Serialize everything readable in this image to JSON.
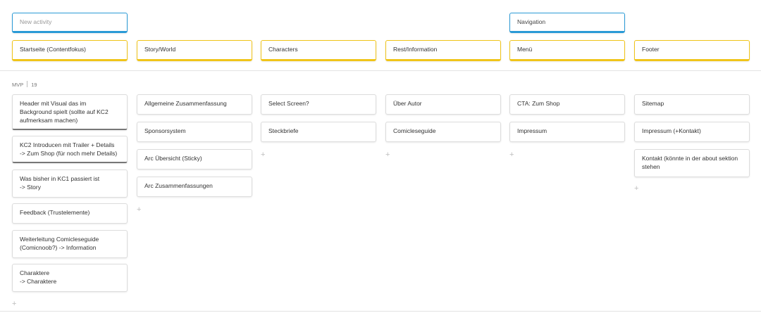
{
  "activities": [
    {
      "label": "New activity",
      "placeholder": true
    },
    {
      "label": "Navigation",
      "placeholder": false
    }
  ],
  "steps": [
    "Startseite (Contentfokus)",
    "Story/World",
    "Characters",
    "Rest/Information",
    "Menü",
    "Footer"
  ],
  "release": {
    "name": "MVP",
    "count": "19"
  },
  "columns": [
    [
      "Header mit Visual das im\nBackground spielt (sollte auf KC2\naufmerksam machen)",
      "KC2 Introducen mit Trailer + Details\n-> Zum Shop (für noch mehr Details)",
      "Was bisher in KC1 passiert ist\n-> Story",
      "Feedback (Trustelemente)",
      "Weiterleitung Comicleseguide\n(Comicnoob?) -> Information",
      "Charaktere\n-> Charaktere"
    ],
    [
      "Allgemeine Zusammenfassung",
      "Sponsorsystem",
      "Arc Übersicht (Sticky)",
      "Arc Zusammenfassungen"
    ],
    [
      "Select Screen?",
      "Steckbriefe"
    ],
    [
      "Über Autor",
      "Comicleseguide"
    ],
    [
      "CTA: Zum Shop",
      "Impressum"
    ],
    [
      "Sitemap",
      "Impressum (+Kontakt)",
      "Kontakt (könnte in der about sektion\nstehen"
    ]
  ],
  "add_symbol": "+"
}
